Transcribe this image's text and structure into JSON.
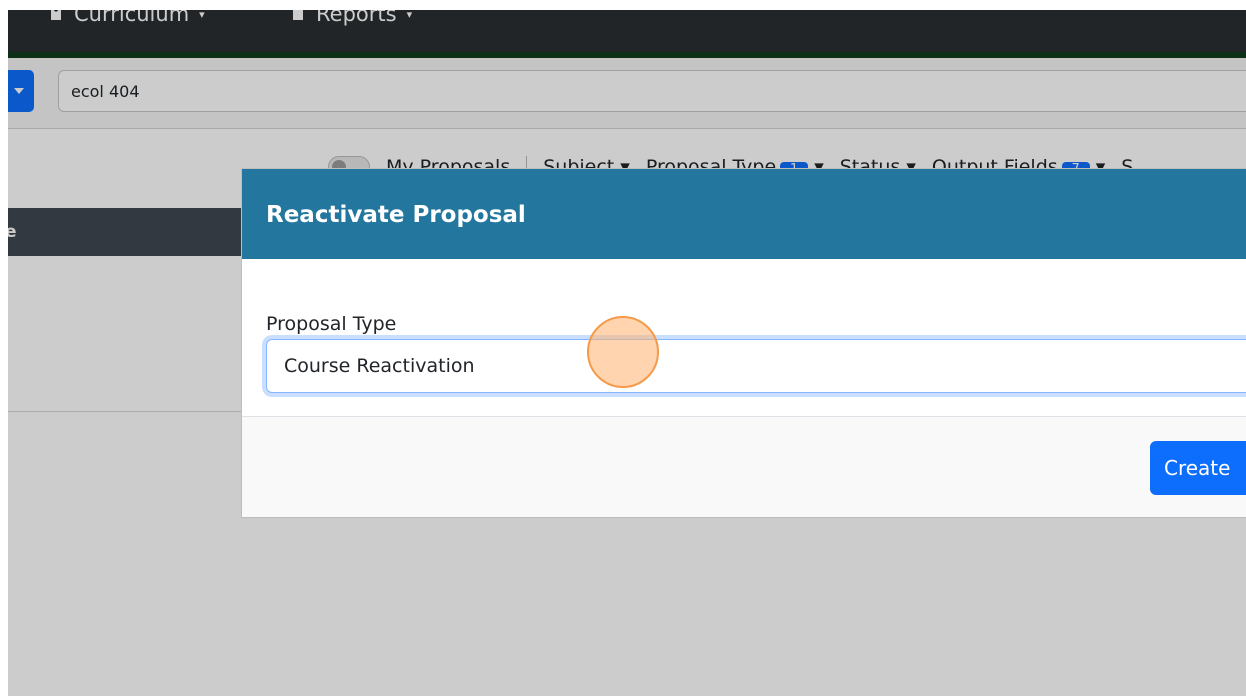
{
  "nav": {
    "curriculum_label": "Curriculum",
    "reports_label": "Reports"
  },
  "search": {
    "value": "ecol 404"
  },
  "filters": {
    "my_proposals": "My Proposals",
    "subject": "Subject",
    "proposal_type": "Proposal Type",
    "proposal_type_count": "1",
    "status": "Status",
    "output_fields": "Output Fields",
    "output_fields_count": "7",
    "more": "S"
  },
  "table": {
    "header_fragment": "e"
  },
  "modal": {
    "title": "Reactivate Proposal",
    "field_label": "Proposal Type",
    "selected_value": "Course Reactivation",
    "create_label": "Create"
  },
  "colors": {
    "modal_header": "#23779e",
    "primary": "#0d6efd",
    "topnav_border": "#0f3d1f"
  }
}
